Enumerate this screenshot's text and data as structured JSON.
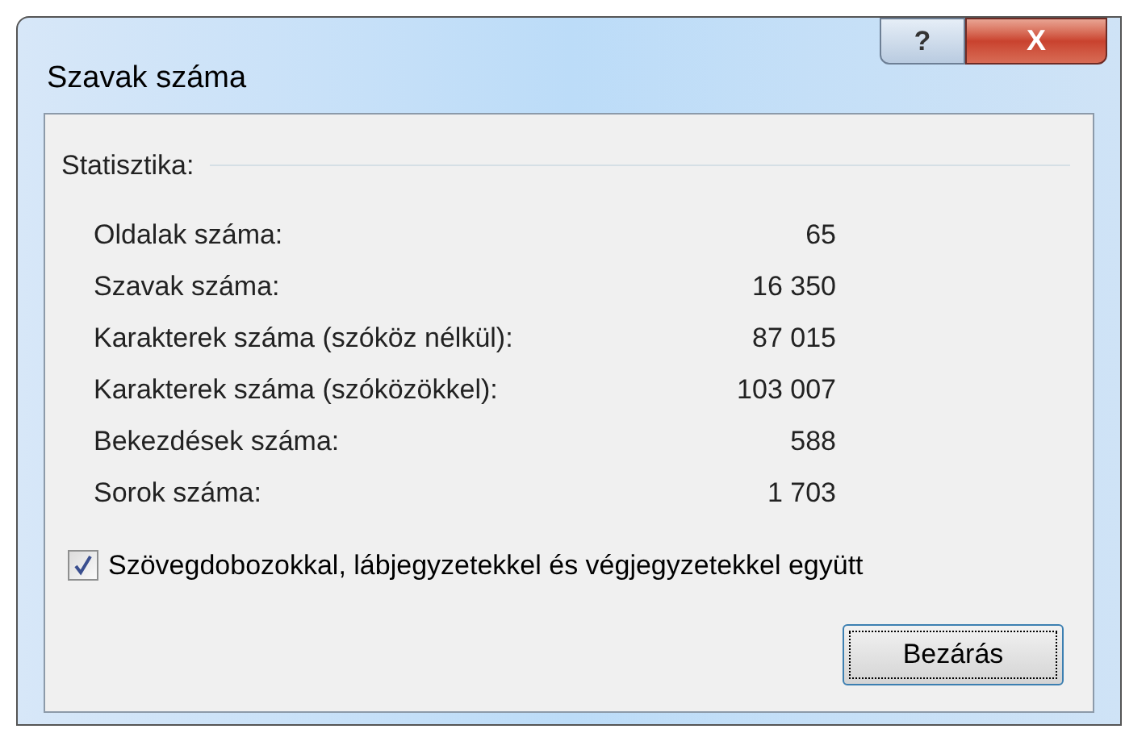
{
  "window": {
    "title": "Szavak száma"
  },
  "title_buttons": [
    {
      "kind": "help",
      "label": "?"
    },
    {
      "kind": "close",
      "label": "X"
    }
  ],
  "group": {
    "label": "Statisztika:"
  },
  "stats": [
    {
      "label": "Oldalak száma:",
      "value": "65"
    },
    {
      "label": "Szavak száma:",
      "value": "16 350"
    },
    {
      "label": "Karakterek száma (szóköz nélkül):",
      "value": "87 015"
    },
    {
      "label": "Karakterek száma (szóközökkel):",
      "value": "103 007"
    },
    {
      "label": "Bekezdések száma:",
      "value": "588"
    },
    {
      "label": "Sorok száma:",
      "value": "1 703"
    }
  ],
  "checkbox": {
    "label": "Szövegdobozokkal, lábjegyzetekkel és végjegyzetekkel együtt",
    "checked": true
  },
  "buttons": [
    {
      "label": "Bezárás"
    }
  ]
}
